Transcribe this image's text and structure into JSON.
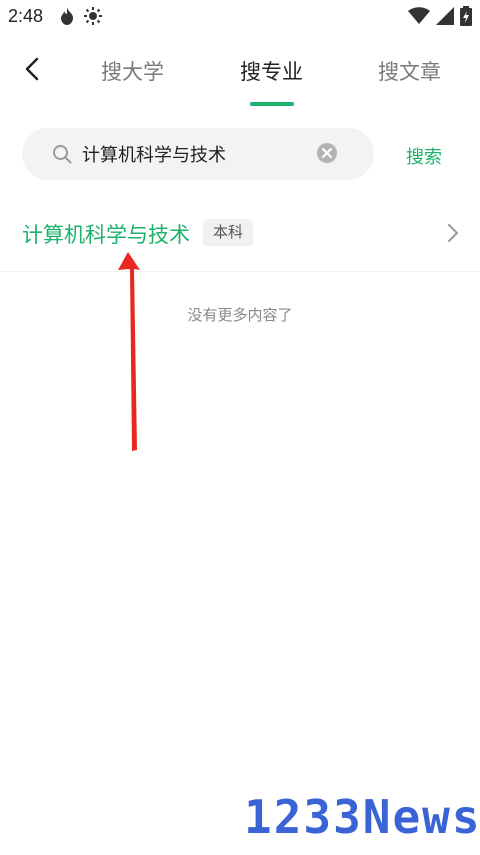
{
  "status_bar": {
    "time": "2:48"
  },
  "nav": {
    "tabs": [
      {
        "label": "搜大学",
        "active": false
      },
      {
        "label": "搜专业",
        "active": true
      },
      {
        "label": "搜文章",
        "active": false
      }
    ]
  },
  "search": {
    "value": "计算机科学与技术",
    "button_label": "搜索"
  },
  "results": [
    {
      "name": "计算机科学与技术",
      "badge": "本科"
    }
  ],
  "end_text": "没有更多内容了",
  "watermark": "1233News",
  "colors": {
    "accent": "#1bb36a",
    "annotation": "#e8281e",
    "watermark": "#3a63d6"
  },
  "icons": [
    "back-arrow-icon",
    "search-icon",
    "clear-icon",
    "chevron-right-icon",
    "wifi-icon",
    "signal-icon",
    "battery-icon",
    "flame-icon",
    "brightness-icon"
  ]
}
